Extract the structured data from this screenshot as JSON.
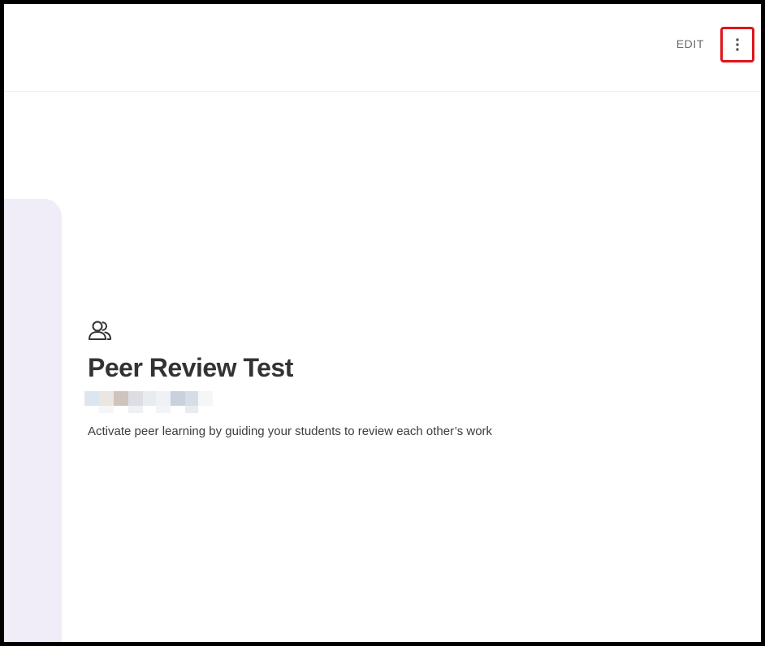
{
  "header": {
    "edit_label": "EDIT",
    "more_icon": "vertical-dots-icon"
  },
  "activity": {
    "type_icon": "people-icon",
    "title": "Peer Review Test",
    "description": "Activate peer learning by guiding your students to review each other’s work"
  },
  "colors": {
    "highlight_border": "#e0141c",
    "side_panel": "#f0ecf8",
    "title_text": "#333333"
  }
}
